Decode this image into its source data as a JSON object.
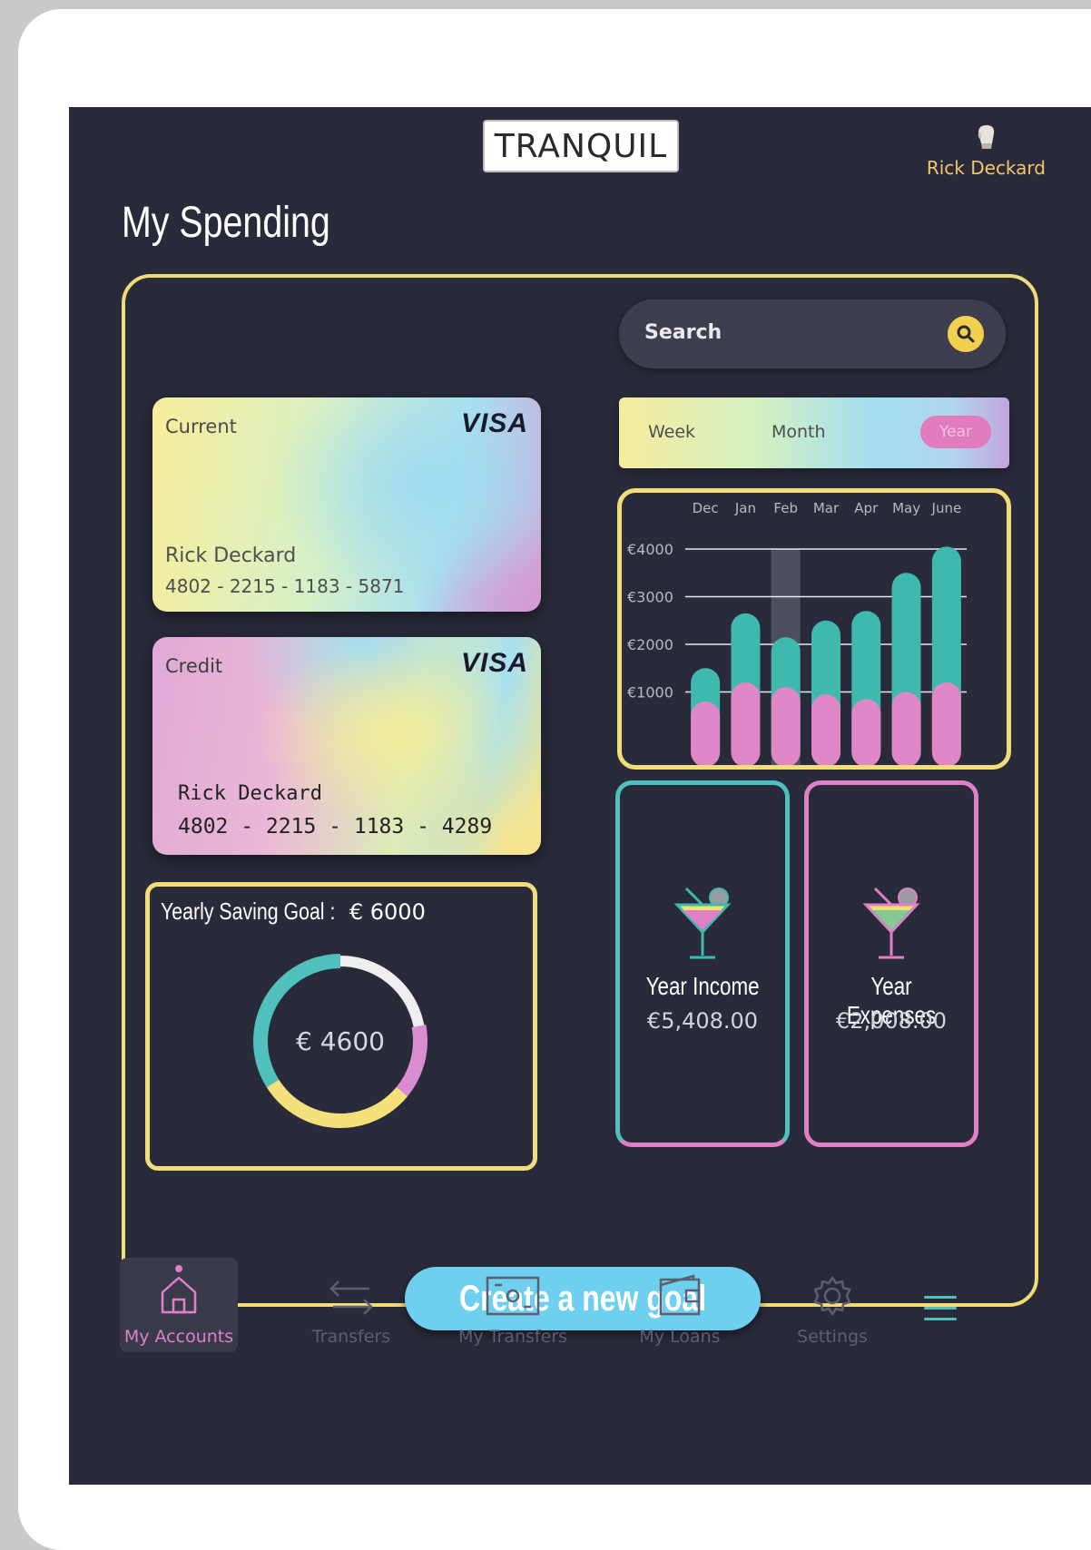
{
  "header": {
    "logo": "TRANQUIL",
    "user_name": "Rick Deckard"
  },
  "page_title": "My Spending",
  "search": {
    "label": "Search"
  },
  "cards": [
    {
      "type": "Current",
      "brand": "VISA",
      "holder": "Rick Deckard",
      "number": "4802 - 2215 - 1183 - 5871"
    },
    {
      "type": "Credit",
      "brand": "VISA",
      "holder": "Rick Deckard",
      "number": "4802 - 2215 - 1183 - 4289"
    }
  ],
  "period": {
    "options": [
      "Week",
      "Month",
      "Year"
    ],
    "selected": "Year"
  },
  "chart_data": {
    "type": "bar",
    "categories": [
      "Dec",
      "Jan",
      "Feb",
      "Mar",
      "Apr",
      "May",
      "June"
    ],
    "series": [
      {
        "values": [
          1500,
          2650,
          2150,
          2500,
          2700,
          3500,
          4050
        ]
      },
      {
        "values": [
          800,
          1200,
          1100,
          950,
          850,
          1000,
          1200
        ]
      }
    ],
    "highlight_category": "Feb",
    "y_ticks": [
      "€4000",
      "€3000",
      "€2000",
      "€1000"
    ],
    "ylim": [
      0,
      4000
    ],
    "grid": true,
    "colors": {
      "series_1": "#3fb8ae",
      "series_2": "#df86c6",
      "grid": "#e8e8ee",
      "highlight": "#565868"
    }
  },
  "saving_goal": {
    "title_lead": "Yearly Saving Goal :",
    "title_amount": "€ 6000",
    "current": "€ 4600",
    "progress_fraction": 0.77
  },
  "stats": [
    {
      "label": "Year Income",
      "amount": "€5,408.00"
    },
    {
      "label": "Year Expenses",
      "amount": "€2,008.00"
    }
  ],
  "cta": {
    "label": "Create a new goal"
  },
  "nav": [
    {
      "label": "My Accounts",
      "icon": "home-icon",
      "active": true
    },
    {
      "label": "Transfers",
      "icon": "arrows-icon",
      "active": false
    },
    {
      "label": "My Transfers",
      "icon": "banknote-icon",
      "active": false
    },
    {
      "label": "My Loans",
      "icon": "wallet-icon",
      "active": false
    },
    {
      "label": "Settings",
      "icon": "gear-icon",
      "active": false
    }
  ],
  "colors": {
    "background": "#292b3b",
    "accent_yellow": "#f2dc7a",
    "accent_pink": "#e080c8",
    "accent_teal": "#4fc0bb",
    "cta": "#6ecfee"
  }
}
